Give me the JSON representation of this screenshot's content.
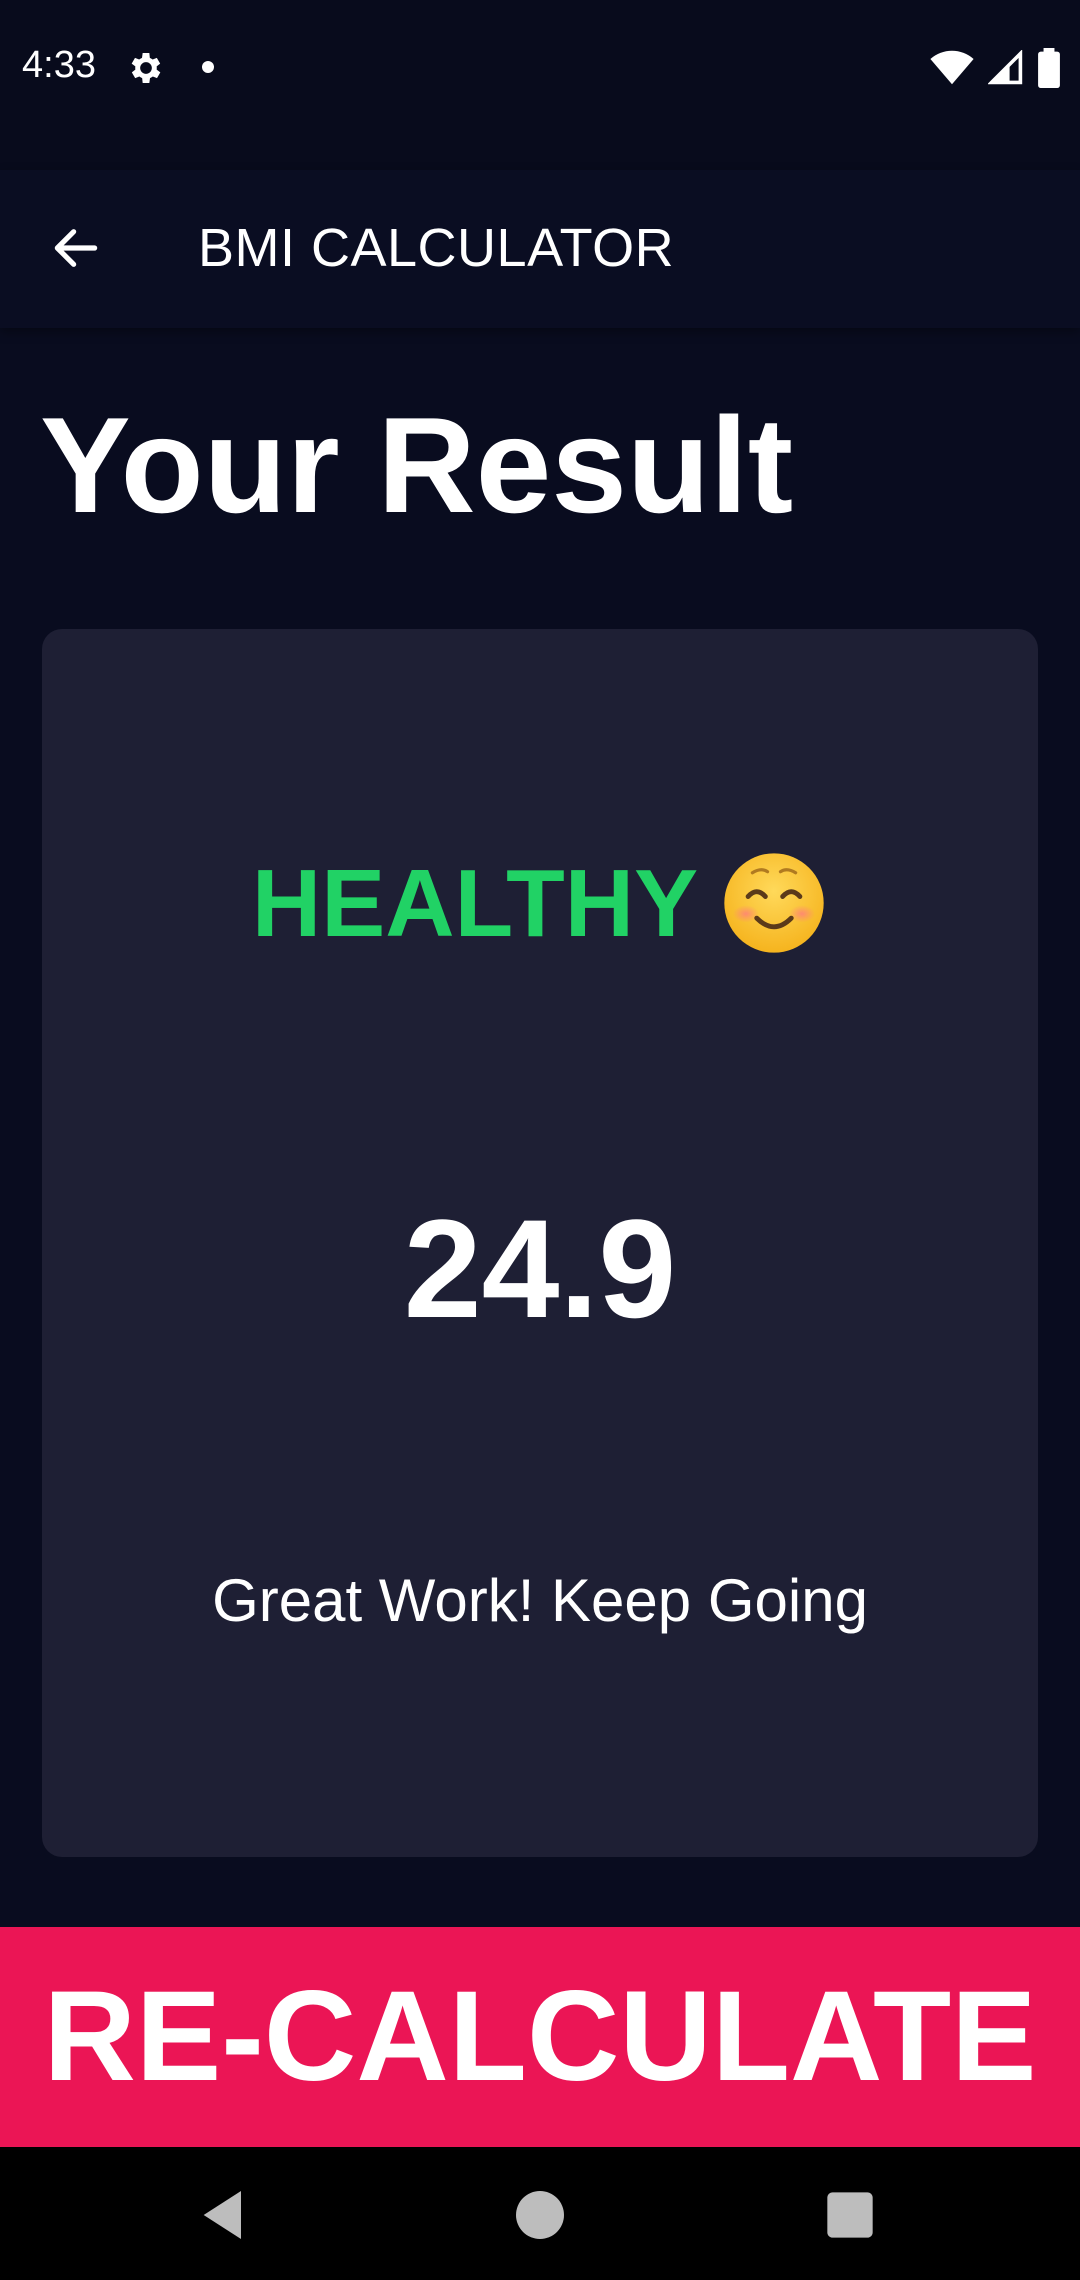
{
  "status_bar": {
    "time": "4:33",
    "icons": [
      "gear-icon",
      "notification-dot-icon",
      "wifi-icon",
      "signal-icon",
      "battery-icon"
    ]
  },
  "app_bar": {
    "title": "BMI CALCULATOR",
    "back_icon": "arrow-left-icon"
  },
  "page": {
    "heading": "Your Result"
  },
  "result": {
    "status": "HEALTHY",
    "status_emoji": "smiling-face-icon",
    "bmi": "24.9",
    "message": "Great Work! Keep Going"
  },
  "action": {
    "recalculate_label": "RE-CALCULATE"
  },
  "colors": {
    "background": "#090c1f",
    "card": "#1e1f34",
    "healthy": "#21d265",
    "accent": "#eb1555"
  },
  "nav_bar": {
    "buttons": [
      "back-triangle-icon",
      "home-circle-icon",
      "recents-square-icon"
    ]
  }
}
